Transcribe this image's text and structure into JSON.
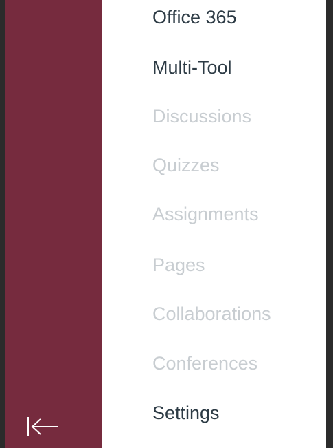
{
  "global_nav": {
    "collapse_icon": "collapse-left-arrow-icon",
    "brand_color": "#762b3e"
  },
  "course_nav": {
    "items": [
      {
        "label": "Office 365",
        "state": "enabled"
      },
      {
        "label": "Multi-Tool",
        "state": "enabled"
      },
      {
        "label": "Discussions",
        "state": "disabled"
      },
      {
        "label": "Quizzes",
        "state": "disabled"
      },
      {
        "label": "Assignments",
        "state": "disabled"
      },
      {
        "label": "Pages",
        "state": "disabled"
      },
      {
        "label": "Collaborations",
        "state": "disabled"
      },
      {
        "label": "Conferences",
        "state": "disabled"
      },
      {
        "label": "Settings",
        "state": "enabled"
      }
    ]
  }
}
